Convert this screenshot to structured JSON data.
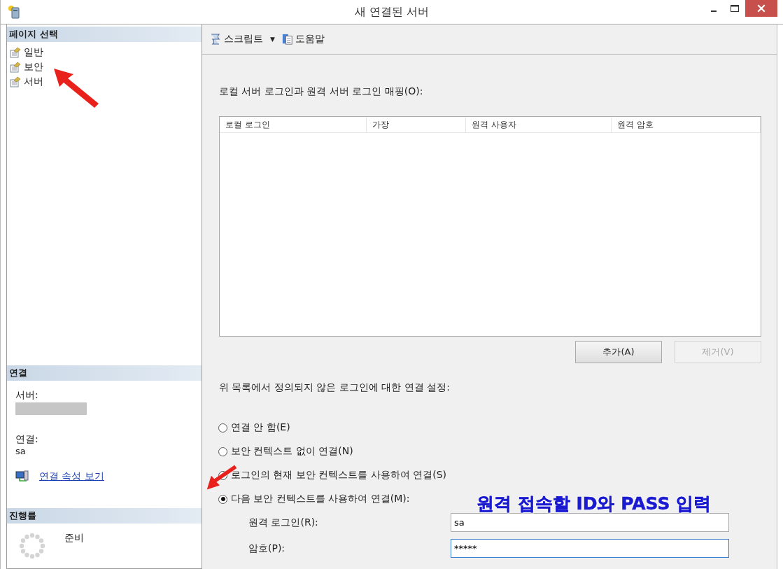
{
  "window": {
    "title": "새 연결된 서버"
  },
  "sidebar": {
    "title": "페이지 선택",
    "items": [
      {
        "label": "일반"
      },
      {
        "label": "보안"
      },
      {
        "label": "서버"
      }
    ]
  },
  "connection": {
    "title": "연결",
    "server_label": "서버:",
    "connection_label": "연결:",
    "connection_value": "sa",
    "link": "연결 속성 보기"
  },
  "progress": {
    "title": "진행률",
    "status": "준비"
  },
  "toolbar": {
    "script": "스크립트",
    "dropdown": "▼",
    "help": "도움말"
  },
  "mapping": {
    "label": "로컬 서버 로그인과 원격 서버 로그인 매핑(O):",
    "columns": [
      "로컬 로그인",
      "가장",
      "원격 사용자",
      "원격 암호"
    ],
    "buttons": [
      {
        "label": "추가(A)",
        "disabled": false
      },
      {
        "label": "제거(V)",
        "disabled": true
      }
    ]
  },
  "settings": {
    "label": "위 목록에서 정의되지 않은 로그인에 대한 연결 설정:",
    "options": [
      {
        "label": "연결 안 함(E)",
        "selected": false
      },
      {
        "label": "보안 컨텍스트 없이 연결(N)",
        "selected": false
      },
      {
        "label": "로그인의 현재 보안 컨텍스트를 사용하여 연결(S)",
        "selected": false
      },
      {
        "label": "다음 보안 컨텍스트를 사용하여 연결(M):",
        "selected": true
      }
    ],
    "fields": [
      {
        "label": "원격 로그인(R):",
        "value": "sa",
        "focused": false
      },
      {
        "label": "암호(P):",
        "value": "*****",
        "focused": true
      }
    ]
  },
  "annotation": {
    "text": "원격 접속할 ID와 PASS 입력"
  }
}
